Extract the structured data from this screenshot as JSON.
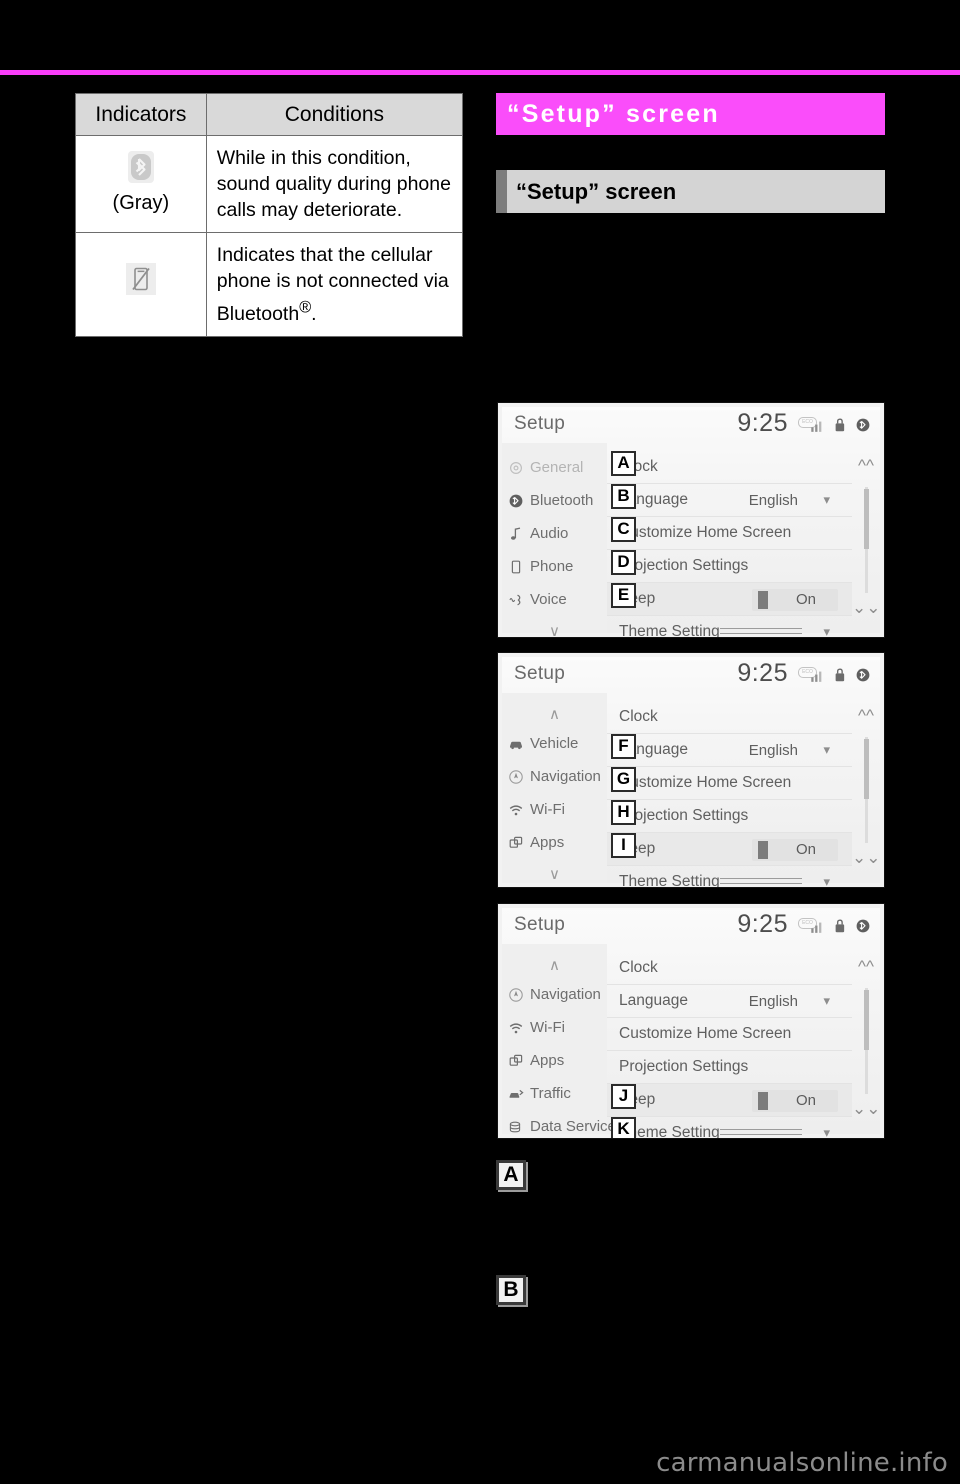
{
  "colors": {
    "chapter_bar": "#fa4dfa",
    "rule": "#f93df9",
    "section_bar": "#d4d4d4",
    "accent_dark": "#7d7d7d"
  },
  "indicator_table": {
    "headers": [
      "Indicators",
      "Conditions"
    ],
    "rows": [
      {
        "icon": "bluetooth-gray-icon",
        "icon_caption": "(Gray)",
        "condition": "While in this condition, sound quality during phone calls may deteriorate."
      },
      {
        "icon": "phone-disconnected-icon",
        "icon_caption": "",
        "condition": "Indicates that the cellular phone is not connected via Bluetooth®."
      }
    ]
  },
  "chapter": {
    "title": "“Setup” screen"
  },
  "section": {
    "title": "“Setup” screen"
  },
  "screenshots": [
    {
      "id": "hu1",
      "status": {
        "title": "Setup",
        "clock": "9:25",
        "pill": "ECO",
        "icons": [
          "signal-icon",
          "lock-icon",
          "bluetooth-icon"
        ]
      },
      "side_items": [
        {
          "label": "General",
          "icon": "gear-icon",
          "dim": true
        },
        {
          "label": "Bluetooth",
          "icon": "bluetooth-icon",
          "dim": false
        },
        {
          "label": "Audio",
          "icon": "music-note-icon",
          "dim": false
        },
        {
          "label": "Phone",
          "icon": "phone-icon",
          "dim": false
        },
        {
          "label": "Voice",
          "icon": "voice-icon",
          "dim": false
        }
      ],
      "side_arrow_top": "",
      "side_arrow_bottom": "∨",
      "rows": [
        {
          "label": "Clock",
          "value": "",
          "chevron": false,
          "toggle": null,
          "lines": false
        },
        {
          "label": "Language",
          "value": "English",
          "chevron": true,
          "toggle": null,
          "lines": false
        },
        {
          "label": "Customize Home Screen",
          "value": "",
          "chevron": false,
          "toggle": null,
          "lines": false
        },
        {
          "label": "Projection Settings",
          "value": "",
          "chevron": false,
          "toggle": null,
          "lines": false
        },
        {
          "label": "Beep",
          "value": "",
          "chevron": false,
          "toggle": "On",
          "lines": false
        },
        {
          "label": "Theme Setting",
          "value": "",
          "chevron": true,
          "toggle": null,
          "lines": true
        }
      ],
      "callouts": [
        {
          "letter": "A",
          "row": 0
        },
        {
          "letter": "B",
          "row": 1
        },
        {
          "letter": "C",
          "row": 2
        },
        {
          "letter": "D",
          "row": 3
        },
        {
          "letter": "E",
          "row": 4
        }
      ]
    },
    {
      "id": "hu2",
      "status": {
        "title": "Setup",
        "clock": "9:25",
        "pill": "ECO",
        "icons": [
          "signal-icon",
          "lock-icon",
          "bluetooth-icon"
        ]
      },
      "side_items": [
        {
          "label": "Vehicle",
          "icon": "car-icon",
          "dim": false
        },
        {
          "label": "Navigation",
          "icon": "compass-icon",
          "dim": false
        },
        {
          "label": "Wi-Fi",
          "icon": "wifi-icon",
          "dim": false
        },
        {
          "label": "Apps",
          "icon": "apps-icon",
          "dim": false
        }
      ],
      "side_arrow_top": "∧",
      "side_arrow_bottom": "∨",
      "rows": [
        {
          "label": "Clock",
          "value": "",
          "chevron": false,
          "toggle": null,
          "lines": false
        },
        {
          "label": "Language",
          "value": "English",
          "chevron": true,
          "toggle": null,
          "lines": false
        },
        {
          "label": "Customize Home Screen",
          "value": "",
          "chevron": false,
          "toggle": null,
          "lines": false
        },
        {
          "label": "Projection Settings",
          "value": "",
          "chevron": false,
          "toggle": null,
          "lines": false
        },
        {
          "label": "Beep",
          "value": "",
          "chevron": false,
          "toggle": "On",
          "lines": false
        },
        {
          "label": "Theme Setting",
          "value": "",
          "chevron": true,
          "toggle": null,
          "lines": true
        }
      ],
      "callouts": [
        {
          "letter": "F",
          "row": 1
        },
        {
          "letter": "G",
          "row": 2
        },
        {
          "letter": "H",
          "row": 3
        },
        {
          "letter": "I",
          "row": 4
        }
      ]
    },
    {
      "id": "hu3",
      "status": {
        "title": "Setup",
        "clock": "9:25",
        "pill": "ECO",
        "icons": [
          "signal-icon",
          "lock-icon",
          "bluetooth-icon"
        ]
      },
      "side_items": [
        {
          "label": "Navigation",
          "icon": "compass-icon",
          "dim": false
        },
        {
          "label": "Wi-Fi",
          "icon": "wifi-icon",
          "dim": false
        },
        {
          "label": "Apps",
          "icon": "apps-icon",
          "dim": false
        },
        {
          "label": "Traffic",
          "icon": "traffic-icon",
          "dim": false
        },
        {
          "label": "Data Services",
          "icon": "data-services-icon",
          "dim": false
        }
      ],
      "side_arrow_top": "∧",
      "side_arrow_bottom": "",
      "rows": [
        {
          "label": "Clock",
          "value": "",
          "chevron": false,
          "toggle": null,
          "lines": false
        },
        {
          "label": "Language",
          "value": "English",
          "chevron": true,
          "toggle": null,
          "lines": false
        },
        {
          "label": "Customize Home Screen",
          "value": "",
          "chevron": false,
          "toggle": null,
          "lines": false
        },
        {
          "label": "Projection Settings",
          "value": "",
          "chevron": false,
          "toggle": null,
          "lines": false
        },
        {
          "label": "Beep",
          "value": "",
          "chevron": false,
          "toggle": "On",
          "lines": false
        },
        {
          "label": "Theme Setting",
          "value": "",
          "chevron": true,
          "toggle": null,
          "lines": true
        }
      ],
      "callouts": [
        {
          "letter": "J",
          "row": 4
        },
        {
          "letter": "K",
          "row": 5
        }
      ]
    }
  ],
  "markers": [
    {
      "letter": "A"
    },
    {
      "letter": "B"
    }
  ],
  "watermark": "carmanualsonline.info"
}
